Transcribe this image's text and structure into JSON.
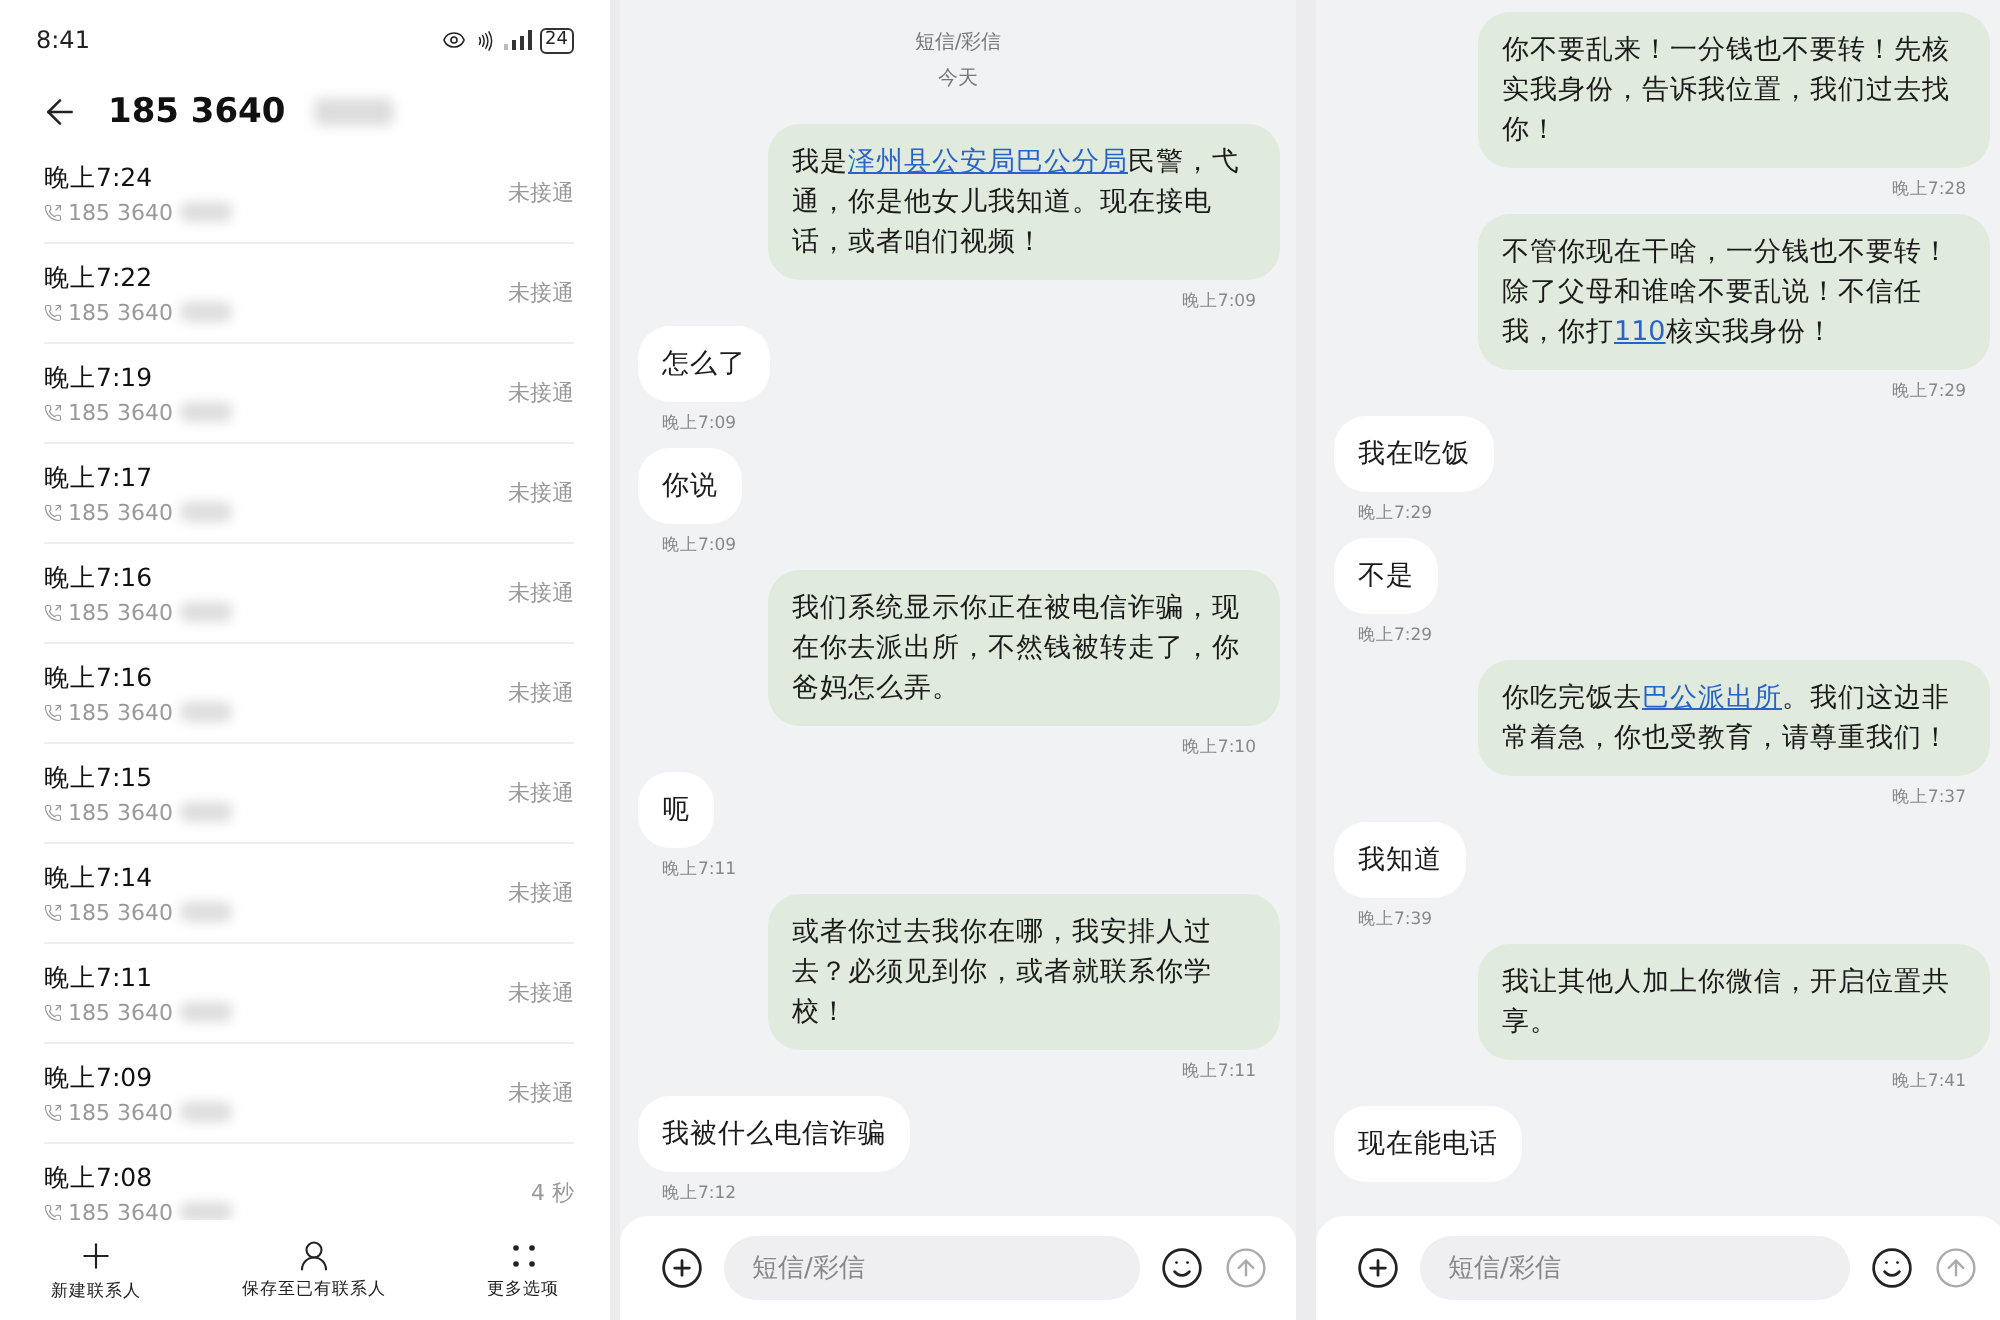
{
  "call_log": {
    "status_bar": {
      "time": "8:41",
      "battery": "24"
    },
    "header": {
      "number": "185 3640"
    },
    "calls": [
      {
        "time": "晚上7:24",
        "number": "185 3640",
        "result": "未接通"
      },
      {
        "time": "晚上7:22",
        "number": "185 3640",
        "result": "未接通"
      },
      {
        "time": "晚上7:19",
        "number": "185 3640",
        "result": "未接通"
      },
      {
        "time": "晚上7:17",
        "number": "185 3640",
        "result": "未接通"
      },
      {
        "time": "晚上7:16",
        "number": "185 3640",
        "result": "未接通"
      },
      {
        "time": "晚上7:16",
        "number": "185 3640",
        "result": "未接通"
      },
      {
        "time": "晚上7:15",
        "number": "185 3640",
        "result": "未接通"
      },
      {
        "time": "晚上7:14",
        "number": "185 3640",
        "result": "未接通"
      },
      {
        "time": "晚上7:11",
        "number": "185 3640",
        "result": "未接通"
      },
      {
        "time": "晚上7:09",
        "number": "185 3640",
        "result": "未接通"
      },
      {
        "time": "晚上7:08",
        "number": "185 3640",
        "result": "4 秒"
      }
    ],
    "toolbar": [
      {
        "kind": "new",
        "label": "新建联系人"
      },
      {
        "kind": "save",
        "label": "保存至已有联系人"
      },
      {
        "kind": "more",
        "label": "更多选项"
      }
    ]
  },
  "chats": [
    {
      "header": {
        "channel": "短信/彩信",
        "date": "今天"
      },
      "messages": [
        {
          "kind": "sent",
          "parts": [
            {
              "text": "我是"
            },
            {
              "text": "泽州县公安局巴公分局",
              "link": true
            },
            {
              "text": "民警，弋通，你是他女儿我知道。现在接电话，或者咱们视频！"
            }
          ],
          "time": "晚上7:09"
        },
        {
          "kind": "received",
          "parts": [
            {
              "text": "怎么了"
            }
          ],
          "time": "晚上7:09"
        },
        {
          "kind": "received",
          "parts": [
            {
              "text": "你说"
            }
          ],
          "time": "晚上7:09"
        },
        {
          "kind": "sent",
          "parts": [
            {
              "text": "我们系统显示你正在被电信诈骗，现在你去派出所，不然钱被转走了，你爸妈怎么弄。"
            }
          ],
          "time": "晚上7:10"
        },
        {
          "kind": "received",
          "parts": [
            {
              "text": "呃"
            }
          ],
          "time": "晚上7:11"
        },
        {
          "kind": "sent",
          "parts": [
            {
              "text": "或者你过去我你在哪，我安排人过去？必须见到你，或者就联系你学校！"
            }
          ],
          "time": "晚上7:11"
        },
        {
          "kind": "received",
          "parts": [
            {
              "text": "我被什么电信诈骗"
            }
          ],
          "time": "晚上7:12"
        }
      ],
      "composer": {
        "placeholder": "短信/彩信"
      }
    },
    {
      "messages": [
        {
          "kind": "sent",
          "parts": [
            {
              "text": "你不要乱来！一分钱也不要转！先核实我身份，告诉我位置，我们过去找你！"
            }
          ],
          "time": "晚上7:28"
        },
        {
          "kind": "sent",
          "parts": [
            {
              "text": "不管你现在干啥，一分钱也不要转！除了父母和谁啥不要乱说！不信任我，你打"
            },
            {
              "text": "110",
              "link": true
            },
            {
              "text": "核实我身份！"
            }
          ],
          "time": "晚上7:29"
        },
        {
          "kind": "received",
          "parts": [
            {
              "text": "我在吃饭"
            }
          ],
          "time": "晚上7:29"
        },
        {
          "kind": "received",
          "parts": [
            {
              "text": "不是"
            }
          ],
          "time": "晚上7:29"
        },
        {
          "kind": "sent",
          "parts": [
            {
              "text": "你吃完饭去"
            },
            {
              "text": "巴公派出所",
              "link": true
            },
            {
              "text": "。我们这边非常着急，你也受教育，请尊重我们！"
            }
          ],
          "time": "晚上7:37"
        },
        {
          "kind": "received",
          "parts": [
            {
              "text": "我知道"
            }
          ],
          "time": "晚上7:39"
        },
        {
          "kind": "sent",
          "parts": [
            {
              "text": "我让其他人加上你微信，开启位置共享。"
            }
          ],
          "time": "晚上7:41"
        },
        {
          "kind": "received",
          "parts": [
            {
              "text": "现在能电话"
            }
          ]
        }
      ],
      "composer": {
        "placeholder": "短信/彩信"
      }
    }
  ]
}
